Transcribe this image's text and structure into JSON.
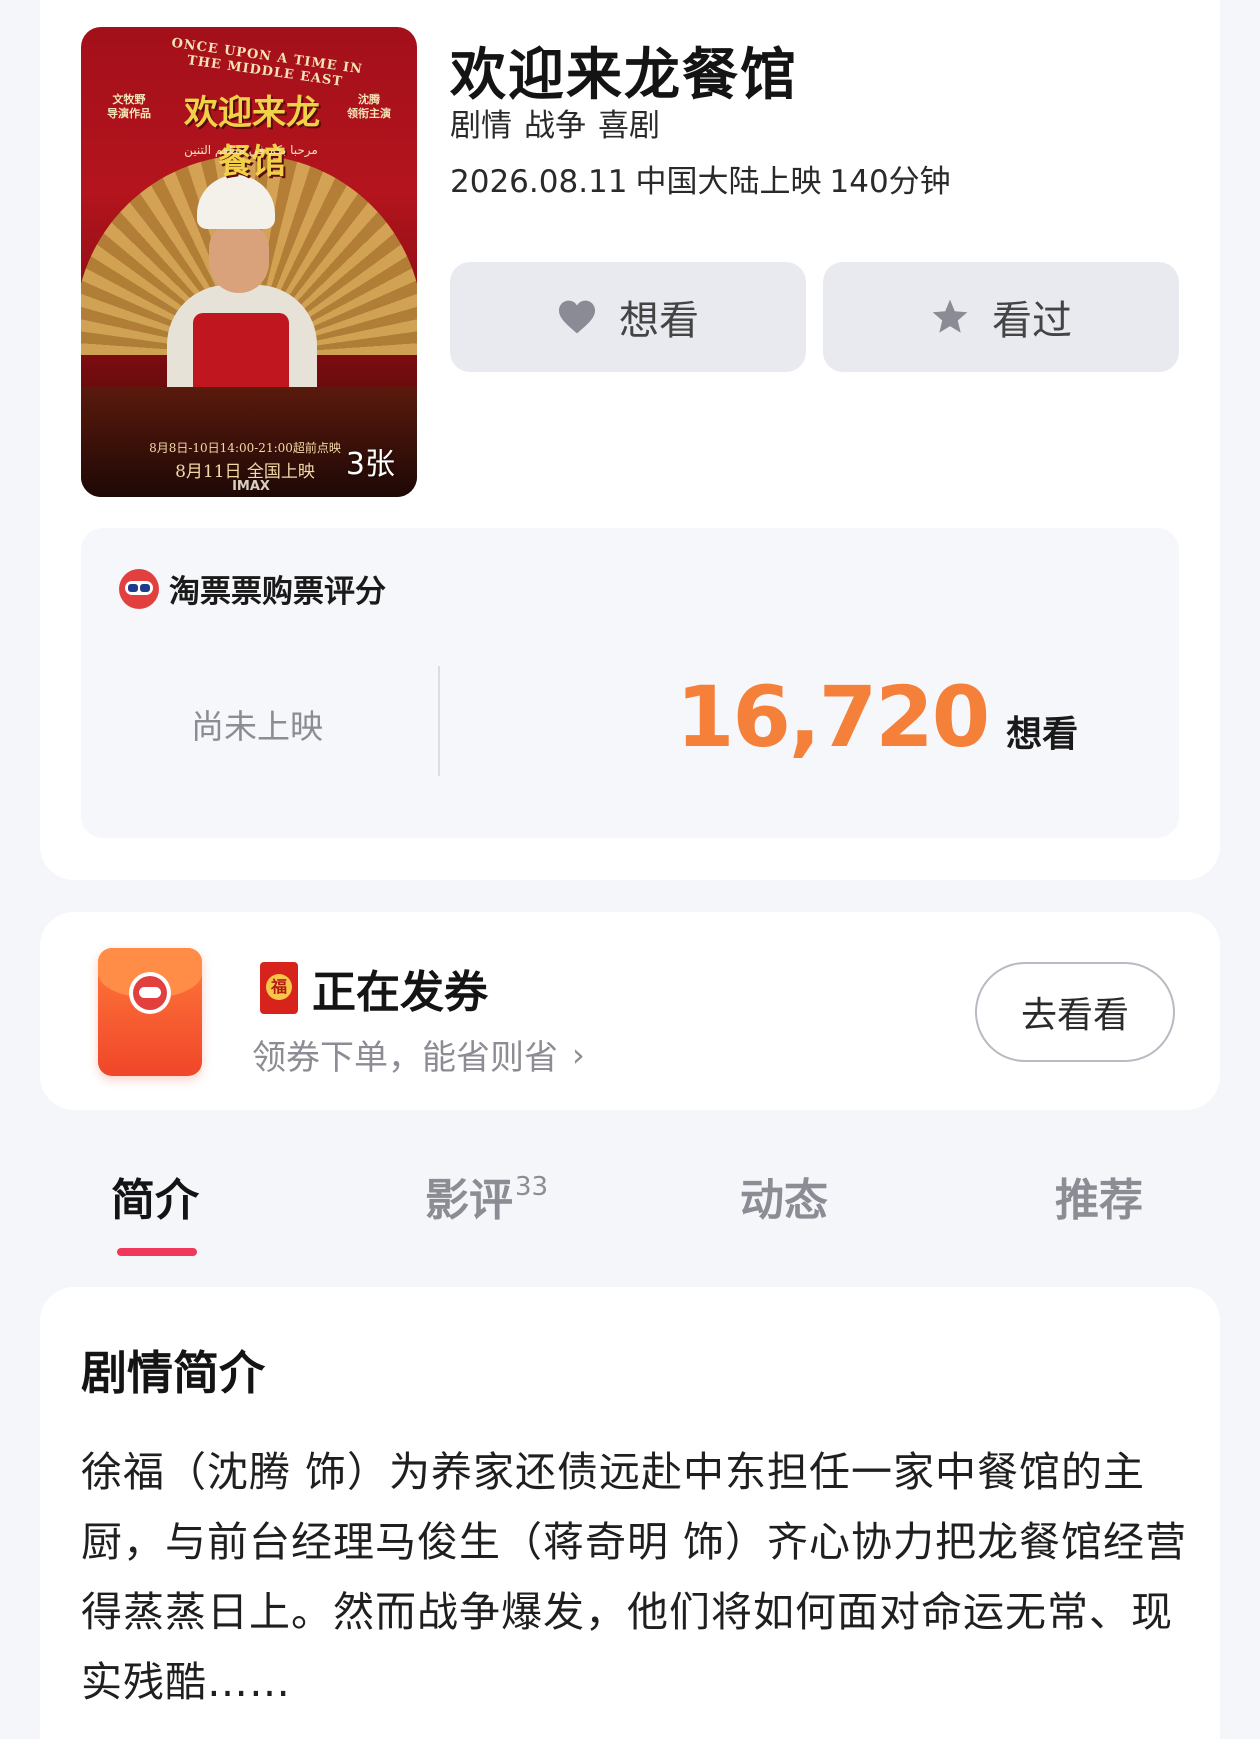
{
  "movie": {
    "title": "欢迎来龙餐馆",
    "genres": [
      "剧情",
      "战争",
      "喜剧"
    ],
    "release_date": "2026.08.11",
    "release_region": "中国大陆上映",
    "duration": "140分钟",
    "poster": {
      "title_en": "ONCE UPON A TIME IN THE MIDDLE EAST",
      "title_cn": "欢迎来龙餐馆",
      "title_ar": "مرحبا بكم في مطعم التنين",
      "credit_left": "文牧野\n导演作品",
      "credit_right": "沈腾\n领衔主演",
      "date_line1": "8月8日-10日14:00-21:00超前点映",
      "date_line2": "8月11日 全国上映",
      "imax": "IMAX",
      "image_count": "3张"
    },
    "want_button": "想看",
    "seen_button": "看过"
  },
  "rating": {
    "header": "淘票票购票评分",
    "status": "尚未上映",
    "want_count": "16,720",
    "want_label": "想看"
  },
  "coupon": {
    "title": "正在发券",
    "subtitle": "领券下单，能省则省",
    "button": "去看看"
  },
  "tabs": [
    {
      "label": "简介",
      "badge": ""
    },
    {
      "label": "影评",
      "badge": "33"
    },
    {
      "label": "动态",
      "badge": ""
    },
    {
      "label": "推荐",
      "badge": ""
    }
  ],
  "synopsis": {
    "title": "剧情简介",
    "text": "徐福（沈腾 饰）为养家还债远赴中东担任一家中餐馆的主厨，与前台经理马俊生（蒋奇明 饰）齐心协力把龙餐馆经营得蒸蒸日上。然而战争爆发，他们将如何面对命运无常、现实残酷……"
  },
  "colors": {
    "accent_orange": "#f4803a",
    "tab_indicator": "#f0385a",
    "brand_red": "#e2403f"
  }
}
